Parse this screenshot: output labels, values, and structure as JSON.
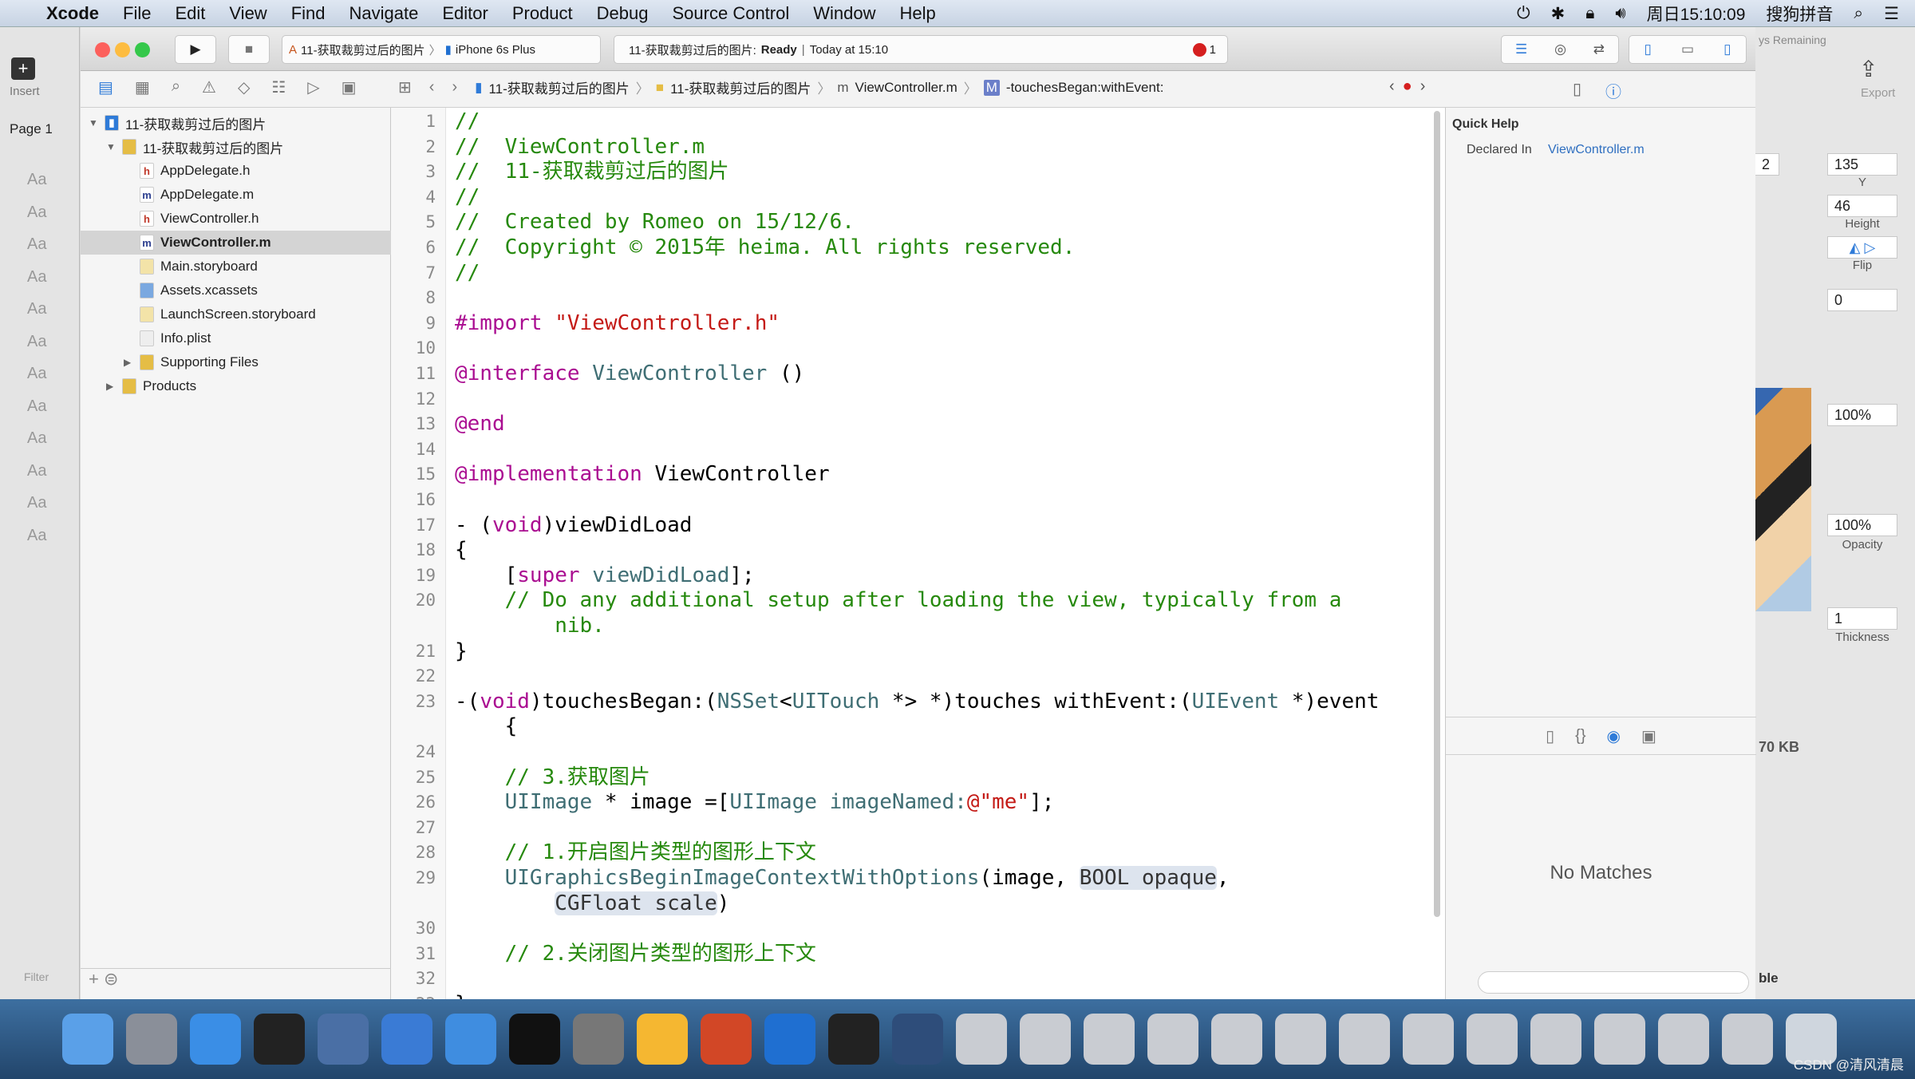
{
  "menubar": {
    "app": "Xcode",
    "items": [
      "File",
      "Edit",
      "View",
      "Find",
      "Navigate",
      "Editor",
      "Product",
      "Debug",
      "Source Control",
      "Window",
      "Help"
    ],
    "clock": "周日15:10:09",
    "ime": "搜狗拼音"
  },
  "sketch_left": {
    "insert": "Insert",
    "page": "Page 1",
    "aa": [
      "Aa",
      "Aa",
      "Aa",
      "Aa",
      "Aa",
      "Aa",
      "Aa",
      "Aa",
      "Aa",
      "Aa",
      "Aa",
      "Aa"
    ],
    "filter": "Filter"
  },
  "toolbar": {
    "scheme": "11-获取裁剪过后的图片",
    "device": "iPhone 6s Plus",
    "status_project": "11-获取裁剪过后的图片:",
    "status_state": "Ready",
    "status_time": "Today at 15:10",
    "error_count": "1"
  },
  "jumpbar": {
    "crumbs": [
      "11-获取裁剪过后的图片",
      "11-获取裁剪过后的图片",
      "ViewController.m",
      "-touchesBegan:withEvent:"
    ]
  },
  "navigator": {
    "items": [
      {
        "label": "11-获取裁剪过后的图片",
        "level": 0,
        "icon": "project",
        "disclosure": "open"
      },
      {
        "label": "11-获取裁剪过后的图片",
        "level": 1,
        "icon": "folder",
        "disclosure": "open"
      },
      {
        "label": "AppDelegate.h",
        "level": 2,
        "icon": "h"
      },
      {
        "label": "AppDelegate.m",
        "level": 2,
        "icon": "m"
      },
      {
        "label": "ViewController.h",
        "level": 2,
        "icon": "h"
      },
      {
        "label": "ViewController.m",
        "level": 2,
        "icon": "m",
        "selected": true
      },
      {
        "label": "Main.storyboard",
        "level": 2,
        "icon": "storyboard"
      },
      {
        "label": "Assets.xcassets",
        "level": 2,
        "icon": "xcassets"
      },
      {
        "label": "LaunchScreen.storyboard",
        "level": 2,
        "icon": "storyboard"
      },
      {
        "label": "Info.plist",
        "level": 2,
        "icon": "plist"
      },
      {
        "label": "Supporting Files",
        "level": 2,
        "icon": "folder",
        "disclosure": "closed"
      },
      {
        "label": "Products",
        "level": 1,
        "icon": "folder",
        "disclosure": "closed"
      }
    ]
  },
  "code": {
    "lines": [
      {
        "n": "1",
        "segs": [
          [
            "//",
            "c"
          ]
        ]
      },
      {
        "n": "2",
        "segs": [
          [
            "//  ViewController.m",
            "c"
          ]
        ]
      },
      {
        "n": "3",
        "segs": [
          [
            "//  11-获取裁剪过后的图片",
            "c"
          ]
        ]
      },
      {
        "n": "4",
        "segs": [
          [
            "//",
            "c"
          ]
        ]
      },
      {
        "n": "5",
        "segs": [
          [
            "//  Created by Romeo on 15/12/6.",
            "c"
          ]
        ]
      },
      {
        "n": "6",
        "segs": [
          [
            "//  Copyright © 2015年 heima. All rights reserved.",
            "c"
          ]
        ]
      },
      {
        "n": "7",
        "segs": [
          [
            "//",
            "c"
          ]
        ]
      },
      {
        "n": "8",
        "segs": []
      },
      {
        "n": "9",
        "segs": [
          [
            "#import ",
            "k"
          ],
          [
            "\"ViewController.h\"",
            "s"
          ]
        ]
      },
      {
        "n": "10",
        "segs": []
      },
      {
        "n": "11",
        "segs": [
          [
            "@interface ",
            "k"
          ],
          [
            "ViewController",
            "t"
          ],
          [
            " ()",
            ""
          ]
        ]
      },
      {
        "n": "12",
        "segs": []
      },
      {
        "n": "13",
        "segs": [
          [
            "@end",
            "k"
          ]
        ]
      },
      {
        "n": "14",
        "segs": []
      },
      {
        "n": "15",
        "segs": [
          [
            "@implementation ",
            "k"
          ],
          [
            "ViewController",
            ""
          ]
        ]
      },
      {
        "n": "16",
        "segs": []
      },
      {
        "n": "17",
        "segs": [
          [
            "- (",
            ""
          ],
          [
            "void",
            "k"
          ],
          [
            ")viewDidLoad",
            ""
          ]
        ]
      },
      {
        "n": "18",
        "segs": [
          [
            "{",
            ""
          ]
        ]
      },
      {
        "n": "19",
        "segs": [
          [
            "    [",
            ""
          ],
          [
            "super",
            "k"
          ],
          [
            " ",
            ""
          ],
          [
            "viewDidLoad",
            "p"
          ],
          [
            "];",
            ""
          ]
        ]
      },
      {
        "n": "20",
        "segs": [
          [
            "    // Do any additional setup after loading the view, typically from a",
            "c"
          ]
        ]
      },
      {
        "n": "",
        "segs": [
          [
            "        nib.",
            "c"
          ]
        ]
      },
      {
        "n": "21",
        "segs": [
          [
            "}",
            ""
          ]
        ]
      },
      {
        "n": "22",
        "segs": []
      },
      {
        "n": "23",
        "segs": [
          [
            "-(",
            ""
          ],
          [
            "void",
            "k"
          ],
          [
            ")touchesBegan:(",
            ""
          ],
          [
            "NSSet",
            "t"
          ],
          [
            "<",
            ""
          ],
          [
            "UITouch",
            "t"
          ],
          [
            " *> *)touches withEvent:(",
            ""
          ],
          [
            "UIEvent",
            "t"
          ],
          [
            " *)event",
            ""
          ]
        ]
      },
      {
        "n": "",
        "segs": [
          [
            "    {",
            ""
          ]
        ]
      },
      {
        "n": "24",
        "segs": []
      },
      {
        "n": "25",
        "segs": [
          [
            "    // 3.获取图片",
            "c"
          ]
        ]
      },
      {
        "n": "26",
        "segs": [
          [
            "    ",
            ""
          ],
          [
            "UIImage",
            "t"
          ],
          [
            " * image =[",
            ""
          ],
          [
            "UIImage",
            "t"
          ],
          [
            " ",
            ""
          ],
          [
            "imageNamed:",
            "p"
          ],
          [
            "@\"me\"",
            "s"
          ],
          [
            "];",
            ""
          ]
        ]
      },
      {
        "n": "27",
        "segs": []
      },
      {
        "n": "28",
        "segs": [
          [
            "    // 1.开启图片类型的图形上下文",
            "c"
          ]
        ]
      },
      {
        "n": "29",
        "segs": [
          [
            "    ",
            ""
          ],
          [
            "UIGraphicsBeginImageContextWithOptions",
            "p"
          ],
          [
            "(image, ",
            ""
          ],
          [
            "BOOL opaque",
            "ph"
          ],
          [
            ",",
            ""
          ]
        ]
      },
      {
        "n": "",
        "segs": [
          [
            "        ",
            ""
          ],
          [
            "CGFloat scale",
            "ph"
          ],
          [
            ")",
            ""
          ]
        ]
      },
      {
        "n": "30",
        "segs": []
      },
      {
        "n": "31",
        "segs": [
          [
            "    // 2.关闭图片类型的图形上下文",
            "c"
          ]
        ]
      },
      {
        "n": "32",
        "segs": []
      },
      {
        "n": "33",
        "segs": [
          [
            "}",
            ""
          ]
        ]
      }
    ]
  },
  "quick_help": {
    "title": "Quick Help",
    "declared_label": "Declared In",
    "declared_value": "ViewController.m",
    "no_matches": "No Matches"
  },
  "sketch_right": {
    "remaining": "ys Remaining",
    "export": "Export",
    "x_partial": "2",
    "y_value": "135",
    "y_label": "Y",
    "height_value": "46",
    "height_label": "Height",
    "flip_label": "Flip",
    "rotate_value": "0",
    "opacity1": "100%",
    "opacity2": "100%",
    "opacity_label": "Opacity",
    "thickness_value": "1",
    "thickness_label": "Thickness",
    "size": "70 KB",
    "bottom": "ble"
  },
  "dock": {
    "apps": [
      "finder",
      "launchpad",
      "safari",
      "mouse",
      "keynote",
      "xcode",
      "xcode-beta",
      "terminal",
      "system-preferences",
      "sketch",
      "powerpoint",
      "teamviewer",
      "console",
      "quicktime",
      "window1",
      "window2",
      "window3",
      "window4",
      "window5",
      "window6",
      "window7",
      "window8",
      "window9",
      "window10",
      "window11",
      "preview",
      "window12",
      "trash"
    ]
  },
  "watermark": "CSDN @清风清晨",
  "colors": {
    "comment": "#26890d",
    "keyword": "#aa0d91",
    "string": "#c41a16",
    "type": "#3f6e74",
    "accent": "#2f7bd8"
  }
}
